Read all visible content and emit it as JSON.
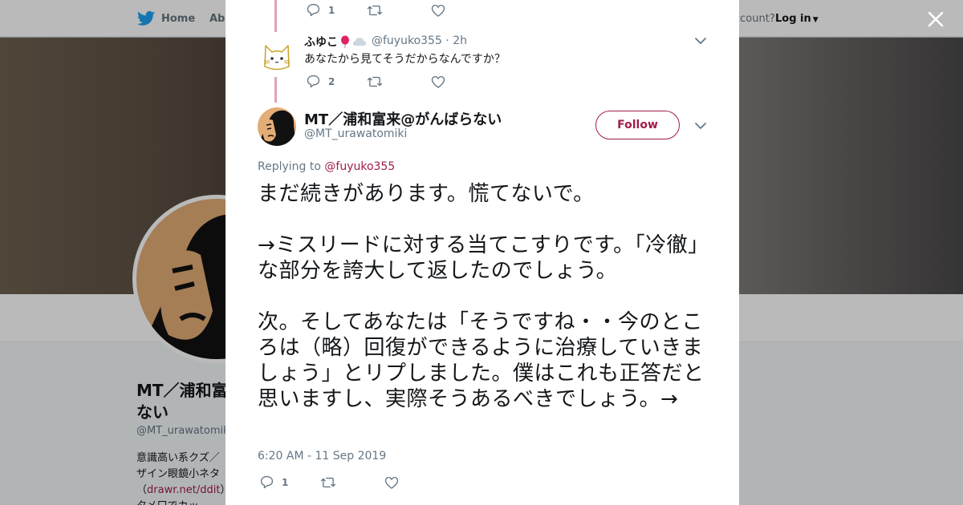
{
  "nav": {
    "home_label": "Home",
    "about_label": "Abo",
    "account_prompt": "ccount?",
    "login_label": "Log in"
  },
  "profile": {
    "name": "MT／浦和富 ない",
    "handle": "@MT_urawatomiki",
    "bio_line1": "意識高い系クズ／",
    "bio_line2": "ザイン眼鏡小ネタ",
    "bio_link": "drawr.net/ddit",
    "bio_line4": "タメ口でカッ"
  },
  "modal": {
    "prev_tweet": {
      "reply_count": "1"
    },
    "reply": {
      "name": "ふゆこ",
      "handle_time": "@fuyuko355 · 2h",
      "text": "あなたから見てそうだからなんですか？",
      "reply_count": "2"
    },
    "main": {
      "name": "MT／浦和富来@がんばらない",
      "handle": "@MT_urawatomiki",
      "follow_label": "Follow",
      "replying_prefix": "Replying to ",
      "replying_to": "@fuyuko355",
      "text": "まだ続きがあります。慌てないで。\n\n→ミスリードに対する当てこすりです。「冷徹」な部分を誇大して返したのでしょう。\n\n次。そしてあなたは「そうですね・・今のところは（略）回復ができるように治療していきましょう」とリプしました。僕はこれも正答だと思いますし、実際そうあるべきでしょう。→",
      "timestamp": "6:20 AM - 11 Sep 2019",
      "reply_count": "1"
    }
  },
  "colors": {
    "accent": "#a01d4a",
    "thread_line": "#e0a2b8",
    "twitter_blue": "#1da1f2",
    "muted": "#657786"
  },
  "icons": [
    "twitter-bird-icon",
    "close-icon",
    "reply-icon",
    "retweet-icon",
    "like-icon",
    "chevron-down-icon",
    "balloon-emoji-icon",
    "cloud-emoji-icon",
    "cat-avatar-icon"
  ]
}
